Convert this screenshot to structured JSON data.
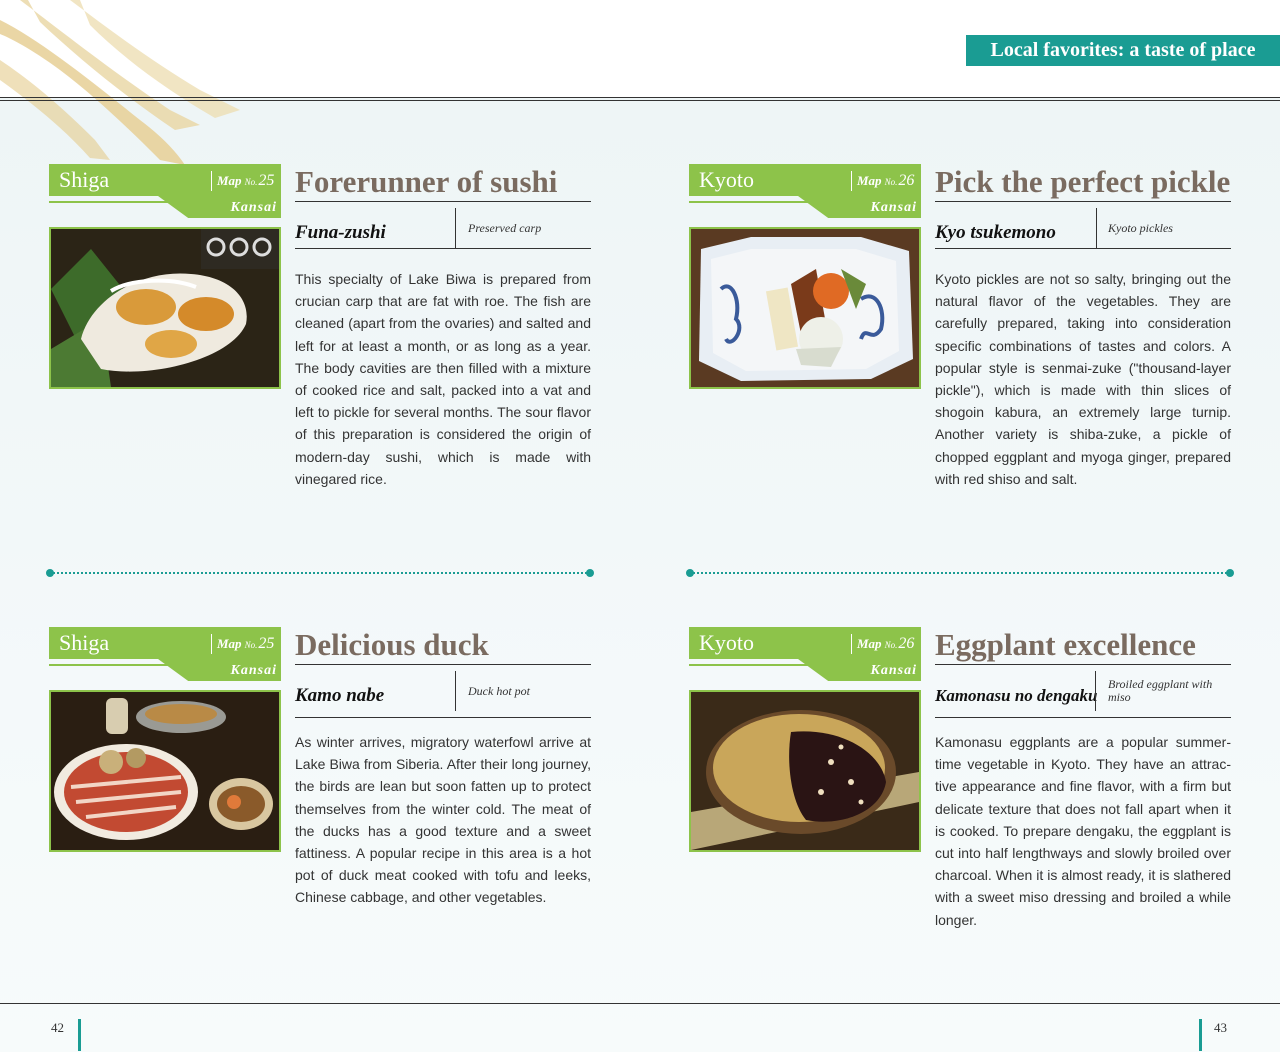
{
  "header": {
    "section_title": "Local favorites: a taste of place"
  },
  "cards": [
    {
      "region": "Shiga",
      "map_label": "Map",
      "map_no_label": "No.",
      "map_number": "25",
      "area": "Kansai",
      "title": "Forerunner of sushi",
      "dish_name": "Funa-zushi",
      "dish_english": "Preserved carp",
      "body": "This specialty of Lake Biwa is prepared from crucian carp that are fat with roe. The fish are cleaned (apart from the ovaries) and salted and left for at least a month, or as long as a year. The body cavities are then filled with a mixture of cooked rice and salt, packed into a vat and left to pickle for several months. The sour flavor of this preparation is considered the origin of modern-day sushi, which is made with vinegared rice."
    },
    {
      "region": "Kyoto",
      "map_label": "Map",
      "map_no_label": "No.",
      "map_number": "26",
      "area": "Kansai",
      "title": "Pick the perfect pickle",
      "dish_name": "Kyo tsukemono",
      "dish_english": "Kyoto pickles",
      "body": "Kyoto pickles are not so salty, bringing out the natural flavor of the vegetables. They are carefully prepared, taking into consideration specific combinations of tastes and colors. A popular style is senmai-zuke (\"thousand-layer pickle\"), which is made with thin slices of shogoin kabura, an extremely large turnip. Another variety is shiba-zuke, a pickle of chopped eggplant and myoga ginger, prepared with red shiso and salt."
    },
    {
      "region": "Shiga",
      "map_label": "Map",
      "map_no_label": "No.",
      "map_number": "25",
      "area": "Kansai",
      "title": "Delicious duck",
      "dish_name": "Kamo nabe",
      "dish_english": "Duck hot pot",
      "body": "As winter arrives, migratory waterfowl arrive at Lake Biwa from Siberia. After their long journey, the birds are lean but soon fatten up to protect themselves from the winter cold. The meat of the ducks has a good texture and a sweet fattiness. A popular recipe in this area is a hot pot of duck meat cooked with tofu and leeks, Chinese cabbage, and other vegetables."
    },
    {
      "region": "Kyoto",
      "map_label": "Map",
      "map_no_label": "No.",
      "map_number": "26",
      "area": "Kansai",
      "title": "Eggplant excellence",
      "dish_name": "Kamonasu no dengaku",
      "dish_english": "Broiled eggplant with miso",
      "body": "Kamonasu eggplants are a popular summer-time vegetable in Kyoto. They have an attrac-tive appearance and fine flavor, with a firm but delicate texture that does not fall apart when it is cooked. To prepare dengaku, the eggplant is cut into half lengthways and slowly broiled over charcoal. When it is almost ready, it is slathered with a sweet miso dressing and broiled a while longer."
    }
  ],
  "footer": {
    "page_left": "42",
    "page_right": "43"
  },
  "colors": {
    "accent_teal": "#1a9c93",
    "accent_green": "#8dc34a",
    "title_brown": "#7a6b60"
  }
}
